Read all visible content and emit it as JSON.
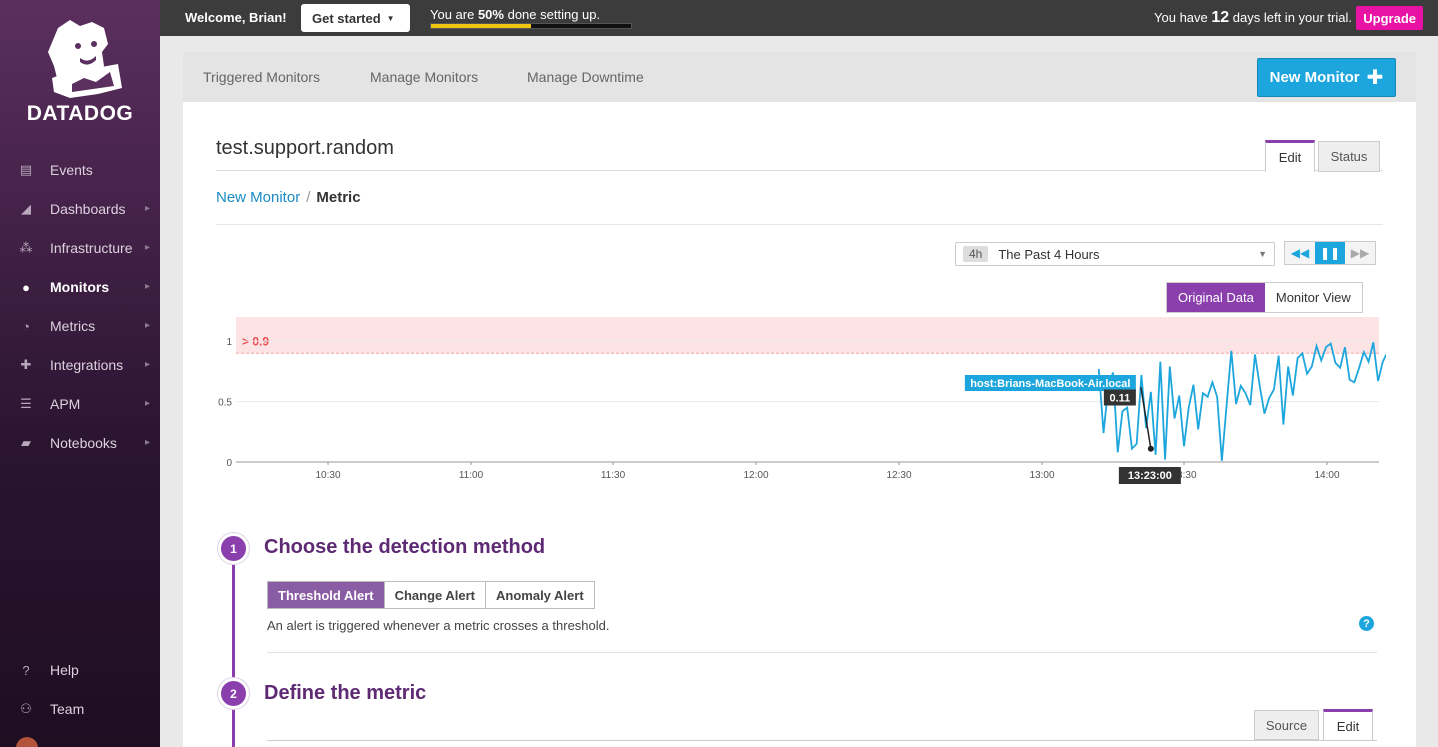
{
  "brand": {
    "name": "DATADOG",
    "accent": "#8a3fac",
    "link": "#1a8cc4",
    "primary": "#1da6de",
    "upgrade": "#e813a5"
  },
  "topbar": {
    "welcome": "Welcome, Brian!",
    "get_started": "Get started",
    "progress_text_pre": "You are ",
    "progress_pct_text": "50%",
    "progress_text_post": " done setting up.",
    "progress_fraction": 0.5,
    "trial_pre": "You have ",
    "trial_days": "12",
    "trial_post": " days left in your trial.",
    "upgrade": "Upgrade"
  },
  "sidebar": {
    "items": [
      {
        "label": "Events",
        "icon": "events-icon"
      },
      {
        "label": "Dashboards",
        "icon": "dashboards-icon"
      },
      {
        "label": "Infrastructure",
        "icon": "infrastructure-icon"
      },
      {
        "label": "Monitors",
        "icon": "monitors-icon",
        "active": true
      },
      {
        "label": "Metrics",
        "icon": "metrics-icon"
      },
      {
        "label": "Integrations",
        "icon": "integrations-icon"
      },
      {
        "label": "APM",
        "icon": "apm-icon"
      },
      {
        "label": "Notebooks",
        "icon": "notebooks-icon"
      }
    ],
    "bottom": [
      {
        "label": "Help",
        "icon": "help-icon"
      },
      {
        "label": "Team",
        "icon": "team-icon"
      }
    ]
  },
  "subnav": {
    "triggered": "Triggered Monitors",
    "manage": "Manage Monitors",
    "downtime": "Manage Downtime",
    "new_monitor": "New Monitor"
  },
  "monitor": {
    "title": "test.support.random",
    "tab_edit": "Edit",
    "tab_status": "Status",
    "breadcrumb_link": "New Monitor",
    "breadcrumb_sep": "/",
    "breadcrumb_current": "Metric"
  },
  "timeframe": {
    "badge": "4h",
    "label": "The Past 4 Hours"
  },
  "view": {
    "original": "Original Data",
    "monitor": "Monitor View"
  },
  "chart_data": {
    "type": "line",
    "x_ticks": [
      "10:30",
      "11:00",
      "11:30",
      "12:00",
      "12:30",
      "13:00",
      "13:30",
      "14:00"
    ],
    "y_ticks": [
      "0",
      "0.5",
      "1"
    ],
    "ylim": [
      0,
      1.2
    ],
    "threshold": 0.9,
    "threshold_label": "> 0.9",
    "series": [
      {
        "name": "host:Brians-MacBook-Air.local",
        "x_minutes_from_13_00": [
          12,
          13,
          14,
          15,
          16,
          17,
          18,
          19,
          20,
          21,
          22,
          23,
          24,
          25,
          26,
          27,
          28,
          29,
          30,
          31,
          32,
          33,
          34,
          35,
          36,
          37,
          38,
          39,
          40,
          41,
          42,
          43,
          44,
          45,
          46,
          47,
          48,
          49,
          50,
          51,
          52,
          53,
          54,
          55,
          56,
          57,
          58,
          59,
          60,
          61,
          62,
          63,
          64,
          65,
          66,
          67,
          68,
          69,
          70,
          71,
          72,
          73,
          74,
          75
        ],
        "values": [
          0.77,
          0.24,
          0.62,
          0.74,
          0.08,
          0.42,
          0.45,
          0.11,
          0.15,
          0.72,
          0.28,
          0.58,
          0.06,
          0.83,
          0.02,
          0.79,
          0.36,
          0.55,
          0.13,
          0.45,
          0.64,
          0.27,
          0.57,
          0.54,
          0.66,
          0.54,
          0.01,
          0.47,
          0.92,
          0.48,
          0.63,
          0.57,
          0.47,
          0.89,
          0.63,
          0.4,
          0.53,
          0.6,
          0.88,
          0.31,
          0.79,
          0.55,
          0.86,
          0.9,
          0.73,
          0.79,
          0.96,
          0.84,
          0.95,
          0.98,
          0.82,
          0.78,
          0.95,
          0.68,
          0.66,
          0.78,
          0.91,
          0.83,
          0.99,
          0.67,
          0.83,
          0.91,
          1.0,
          0.66
        ]
      }
    ],
    "tooltip": {
      "host": "host:Brians-MacBook-Air.local",
      "value": "0.11",
      "time": "13:23:00"
    }
  },
  "steps": [
    {
      "num": "1",
      "title": "Choose the detection method"
    },
    {
      "num": "2",
      "title": "Define the metric"
    }
  ],
  "detection": {
    "options": [
      "Threshold Alert",
      "Change Alert",
      "Anomaly Alert"
    ],
    "selected": "Threshold Alert",
    "description": "An alert is triggered whenever a metric crosses a threshold.",
    "help": "?"
  },
  "metric_tabs": {
    "source": "Source",
    "edit": "Edit"
  }
}
